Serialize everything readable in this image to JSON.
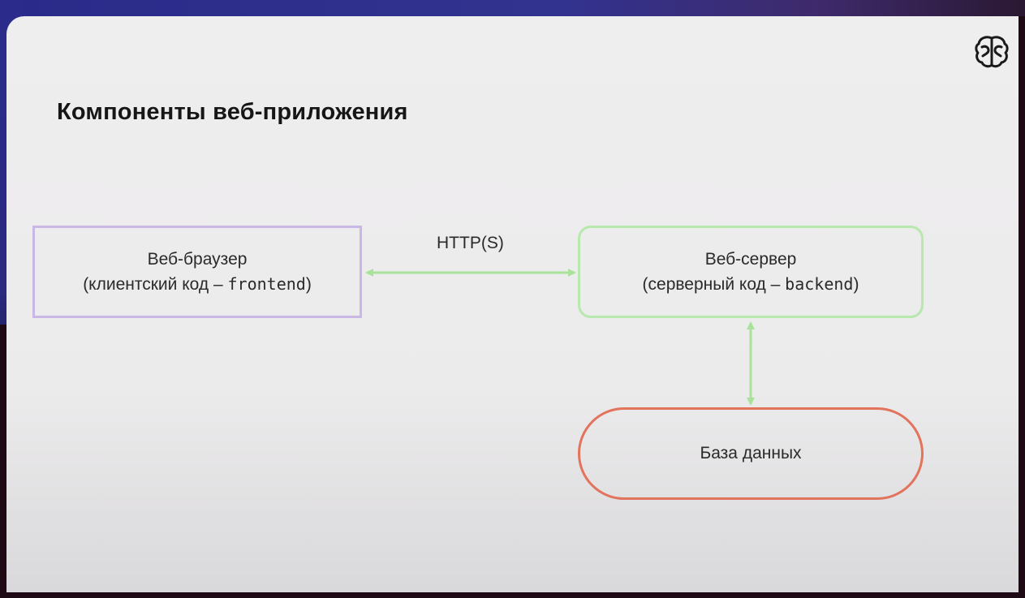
{
  "slide": {
    "title": "Компоненты веб-приложения"
  },
  "diagram": {
    "nodes": {
      "browser": {
        "line1": "Веб-браузер",
        "line2_prefix": "(клиентский код – ",
        "line2_code": "frontend",
        "line2_suffix": ")"
      },
      "server": {
        "line1": "Веб-сервер",
        "line2_prefix": "(серверный код – ",
        "line2_code": "backend",
        "line2_suffix": ")"
      },
      "database": {
        "label": "База данных"
      }
    },
    "edges": {
      "browser_server": {
        "label": "HTTP(S)"
      }
    },
    "colors": {
      "browser_border": "#c9b8e6",
      "server_border": "#b7e8ad",
      "database_border": "#e2735c",
      "arrow": "#a8e29b"
    }
  },
  "logo": {
    "icon": "brain-logo-icon"
  }
}
